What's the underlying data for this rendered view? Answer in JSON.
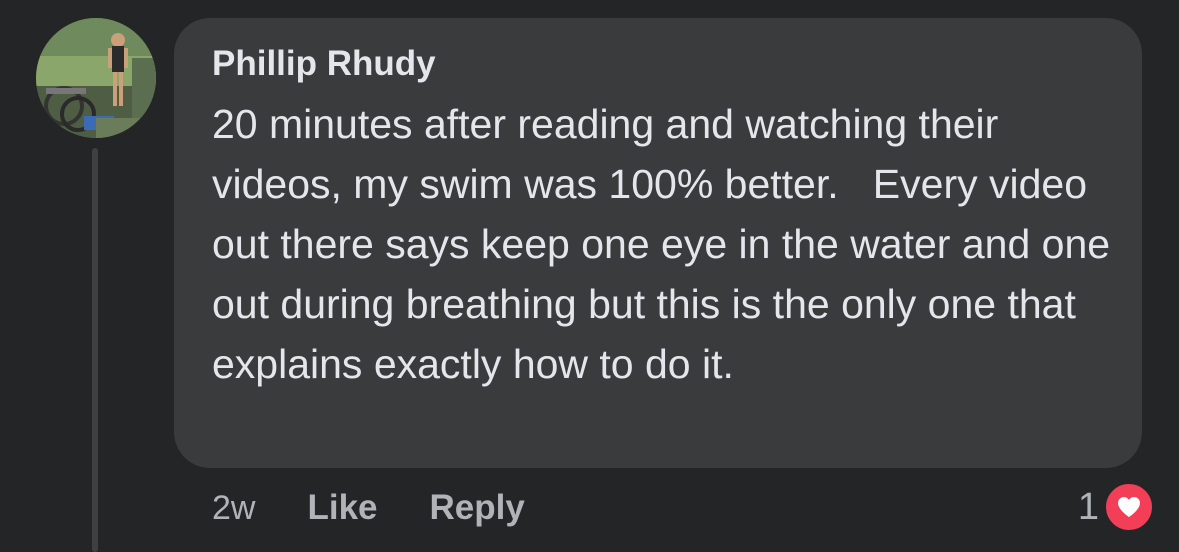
{
  "comment": {
    "author": "Phillip Rhudy",
    "text": "20 minutes after reading and watching their videos, my swim was 100% better.   Every video out there says keep one eye in the water and one out during breathing but this is the only one that explains exactly how to do it.",
    "timestamp": "2w",
    "like_label": "Like",
    "reply_label": "Reply",
    "reaction_count": "1",
    "reaction_type": "heart-icon"
  },
  "colors": {
    "background": "#242526",
    "bubble": "#3a3b3c",
    "text_primary": "#e4e6eb",
    "text_secondary": "#b0b3b8",
    "heart": "#f33e58"
  }
}
